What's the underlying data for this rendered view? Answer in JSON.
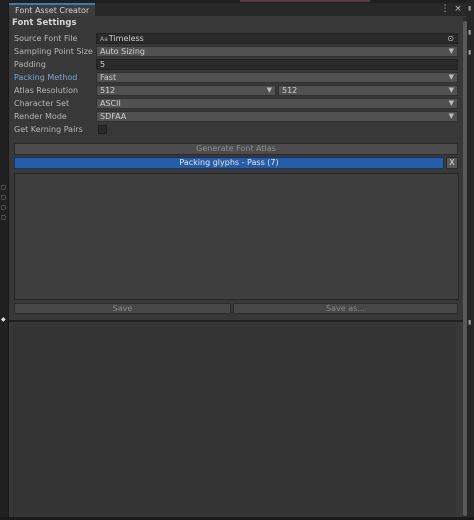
{
  "window": {
    "tab_title": "Font Asset Creator",
    "menu_glyph": "⋮",
    "close_glyph": "×"
  },
  "section": {
    "header": "Font Settings"
  },
  "fields": {
    "source_font_file": {
      "label": "Source Font File",
      "value": "Timeless",
      "prefix_icon": "Aa",
      "target_glyph": "⊙"
    },
    "sampling_point_size": {
      "label": "Sampling Point Size",
      "value": "Auto Sizing"
    },
    "padding": {
      "label": "Padding",
      "value": "5"
    },
    "packing_method": {
      "label": "Packing Method",
      "value": "Fast"
    },
    "atlas_resolution": {
      "label": "Atlas Resolution",
      "width": "512",
      "height": "512"
    },
    "character_set": {
      "label": "Character Set",
      "value": "ASCII"
    },
    "render_mode": {
      "label": "Render Mode",
      "value": "SDFAA"
    },
    "get_kerning_pairs": {
      "label": "Get Kerning Pairs",
      "checked": false
    }
  },
  "dropdown_arrow": "▼",
  "actions": {
    "generate": "Generate Font Atlas",
    "progress_text": "Packing glyphs - Pass (7)",
    "cancel": "X",
    "save": "Save",
    "save_as": "Save as..."
  },
  "colors": {
    "accent": "#3a79bb",
    "progress": "#255da8",
    "active_label": "#7ba7d8",
    "panel": "#383838"
  }
}
